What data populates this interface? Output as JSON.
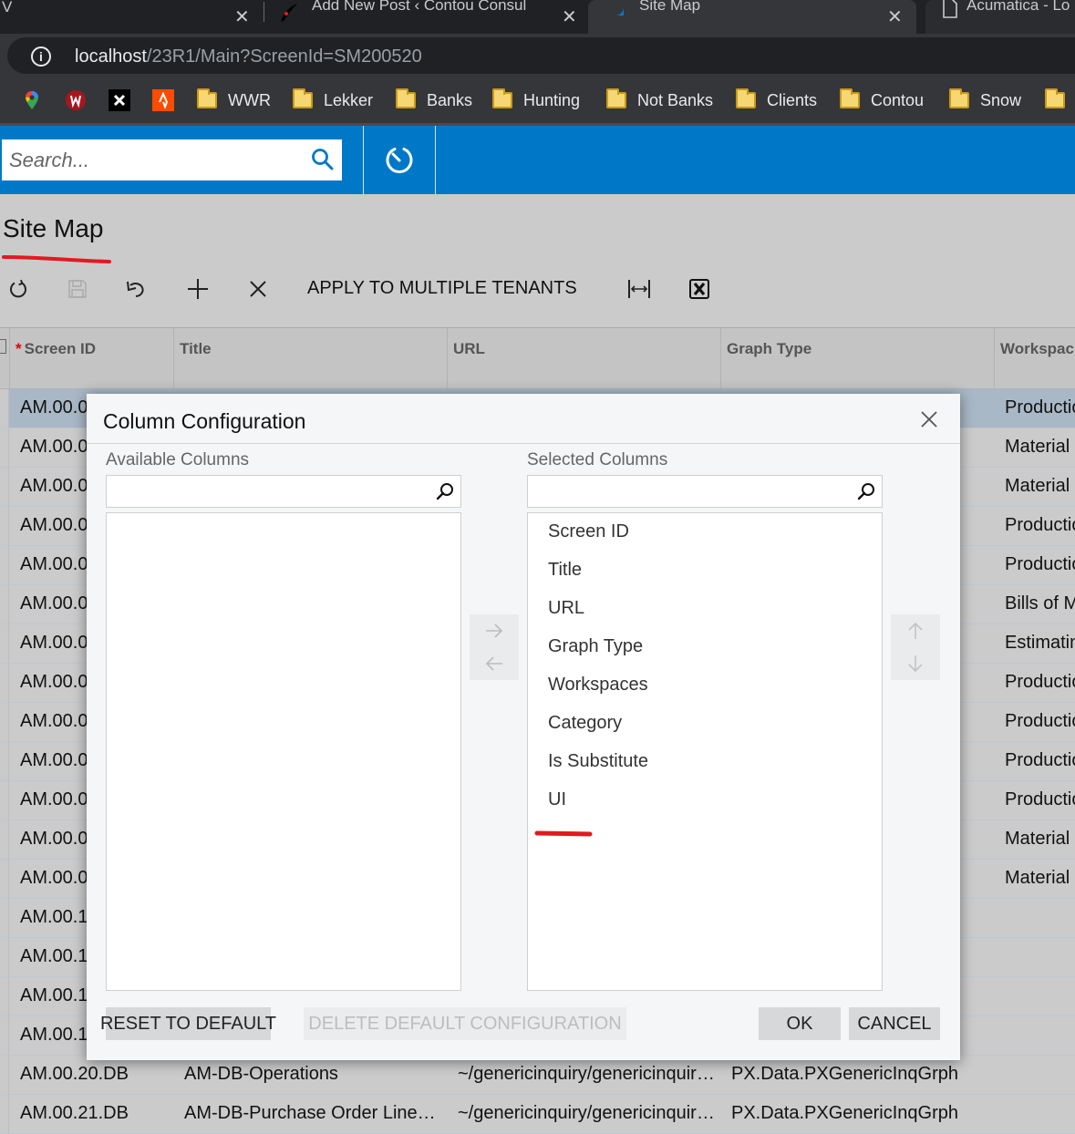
{
  "browser": {
    "tabs": [
      {
        "title": "",
        "partial": true
      },
      {
        "title": "Add New Post ‹ Contou Consulting",
        "icon": "quill-icon"
      },
      {
        "title": "Site Map",
        "icon": "acumatica-icon",
        "active": true
      },
      {
        "title": "Acumatica - Lo",
        "icon": "page-icon"
      }
    ],
    "partial_tab_letter": "V",
    "address": {
      "host": "localhost",
      "path": "/23R1/Main?ScreenId=SM200520"
    },
    "bookmark_icons": [
      "google-maps-icon",
      "red-w-icon",
      "x-icon",
      "strava-icon"
    ],
    "bookmarks": [
      "WWR",
      "Lekker",
      "Banks",
      "Hunting",
      "Not Banks",
      "Clients",
      "Contou",
      "Snow",
      ""
    ]
  },
  "app": {
    "search_placeholder": "Search...",
    "brand_color": "#0078c8"
  },
  "page": {
    "title": "Site Map",
    "toolbar": {
      "apply_tenants_label": "APPLY TO MULTIPLE TENANTS",
      "icons": [
        "refresh-icon",
        "save-icon",
        "undo-icon",
        "add-icon",
        "delete-icon",
        "fit-columns-icon",
        "excel-export-icon"
      ]
    }
  },
  "grid": {
    "columns": [
      {
        "label": "Screen ID",
        "required": true
      },
      {
        "label": "Title"
      },
      {
        "label": "URL"
      },
      {
        "label": "Graph Type"
      },
      {
        "label": "Workspac"
      }
    ],
    "rows": [
      {
        "screen_id": "AM.00.0",
        "title": "",
        "url": "",
        "graph_type": "",
        "workspace": "Productio",
        "selected": true
      },
      {
        "screen_id": "AM.00.0",
        "title": "",
        "url": "",
        "graph_type": "",
        "workspace": "Material "
      },
      {
        "screen_id": "AM.00.0",
        "title": "",
        "url": "",
        "graph_type": "",
        "workspace": "Material "
      },
      {
        "screen_id": "AM.00.0",
        "title": "",
        "url": "",
        "graph_type": "",
        "workspace": "Productio"
      },
      {
        "screen_id": "AM.00.0",
        "title": "",
        "url": "",
        "graph_type": "",
        "workspace": "Productio"
      },
      {
        "screen_id": "AM.00.0",
        "title": "",
        "url": "",
        "graph_type": "",
        "workspace": "Bills of M"
      },
      {
        "screen_id": "AM.00.0",
        "title": "",
        "url": "",
        "graph_type": "",
        "workspace": "Estimatin"
      },
      {
        "screen_id": "AM.00.0",
        "title": "",
        "url": "",
        "graph_type": "",
        "workspace": "Productio"
      },
      {
        "screen_id": "AM.00.0",
        "title": "",
        "url": "",
        "graph_type": "",
        "workspace": "Productio"
      },
      {
        "screen_id": "AM.00.0",
        "title": "",
        "url": "",
        "graph_type": "",
        "workspace": "Productio"
      },
      {
        "screen_id": "AM.00.0",
        "title": "",
        "url": "",
        "graph_type": "",
        "workspace": "Productio"
      },
      {
        "screen_id": "AM.00.0",
        "title": "",
        "url": "",
        "graph_type": "",
        "workspace": "Material "
      },
      {
        "screen_id": "AM.00.0",
        "title": "",
        "url": "",
        "graph_type": "",
        "workspace": "Material "
      },
      {
        "screen_id": "AM.00.1",
        "title": "",
        "url": "",
        "graph_type": "",
        "workspace": ""
      },
      {
        "screen_id": "AM.00.1",
        "title": "",
        "url": "",
        "graph_type": "",
        "workspace": ""
      },
      {
        "screen_id": "AM.00.1",
        "title": "",
        "url": "",
        "graph_type": "",
        "workspace": ""
      },
      {
        "screen_id": "AM.00.1",
        "title": "",
        "url": "",
        "graph_type": "",
        "workspace": ""
      },
      {
        "screen_id": "AM.00.20.DB",
        "title": "AM-DB-Operations",
        "url": "~/genericinquiry/genericinquir…",
        "graph_type": "PX.Data.PXGenericInqGrph",
        "workspace": ""
      },
      {
        "screen_id": "AM.00.21.DB",
        "title": "AM-DB-Purchase Order Line…",
        "url": "~/genericinquiry/genericinquir…",
        "graph_type": "PX.Data.PXGenericInqGrph",
        "workspace": ""
      }
    ]
  },
  "dialog": {
    "title": "Column Configuration",
    "available_label": "Available Columns",
    "available_search_value": "",
    "available_items": [],
    "selected_label": "Selected Columns",
    "selected_search_value": "",
    "selected_items": [
      "Screen ID",
      "Title",
      "URL",
      "Graph Type",
      "Workspaces",
      "Category",
      "Is Substitute",
      "UI"
    ],
    "buttons": {
      "reset": "RESET TO DEFAULT",
      "delete_default": "DELETE DEFAULT CONFIGURATION",
      "ok": "OK",
      "cancel": "CANCEL"
    }
  },
  "annotations": {
    "marker_color": "#e3191f"
  }
}
